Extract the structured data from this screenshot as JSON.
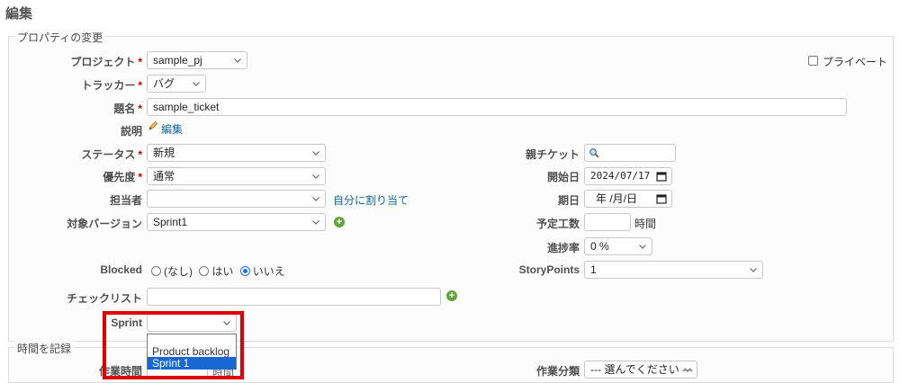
{
  "page": {
    "title": "編集"
  },
  "properties": {
    "legend": "プロパティの変更",
    "project": {
      "label": "プロジェクト",
      "value": "sample_pj"
    },
    "private": {
      "label": "プライベート",
      "checked": false
    },
    "tracker": {
      "label": "トラッカー",
      "value": "バグ"
    },
    "subject": {
      "label": "題名",
      "value": "sample_ticket"
    },
    "description": {
      "label": "説明",
      "edit_link": "編集"
    },
    "required_mark": "*",
    "status": {
      "label": "ステータス",
      "value": "新規"
    },
    "priority": {
      "label": "優先度",
      "value": "通常"
    },
    "assignee": {
      "label": "担当者",
      "value": "",
      "assign_self_link": "自分に割り当て"
    },
    "target_version": {
      "label": "対象バージョン",
      "value": "Sprint1"
    },
    "blocked": {
      "label": "Blocked",
      "options": [
        {
          "label": "(なし)",
          "selected": false
        },
        {
          "label": "はい",
          "selected": false
        },
        {
          "label": "いいえ",
          "selected": true
        }
      ]
    },
    "checklist": {
      "label": "チェックリスト",
      "value": ""
    },
    "sprint": {
      "label": "Sprint",
      "value": "",
      "dropdown_options": [
        {
          "label": "",
          "selected": false
        },
        {
          "label": "Product backlog",
          "selected": false
        },
        {
          "label": "Sprint 1",
          "selected": true
        }
      ]
    },
    "parent_task": {
      "label": "親チケット",
      "value": ""
    },
    "start_date": {
      "label": "開始日",
      "value": "2024/07/17"
    },
    "due_date": {
      "label": "期日",
      "value": "年 /月/日"
    },
    "estimated_time": {
      "label": "予定工数",
      "value": "",
      "unit": "時間"
    },
    "done_ratio": {
      "label": "進捗率",
      "value": "0 %"
    },
    "story_points": {
      "label": "StoryPoints",
      "value": "1"
    }
  },
  "time_log": {
    "legend": "時間を記録",
    "hours": {
      "label": "作業時間",
      "unit_partial": "時間"
    },
    "activity": {
      "label": "作業分類",
      "value": "--- 選んでください ---"
    }
  },
  "colors": {
    "highlight": "#e00000",
    "link": "#116699",
    "required": "#bb0000"
  }
}
